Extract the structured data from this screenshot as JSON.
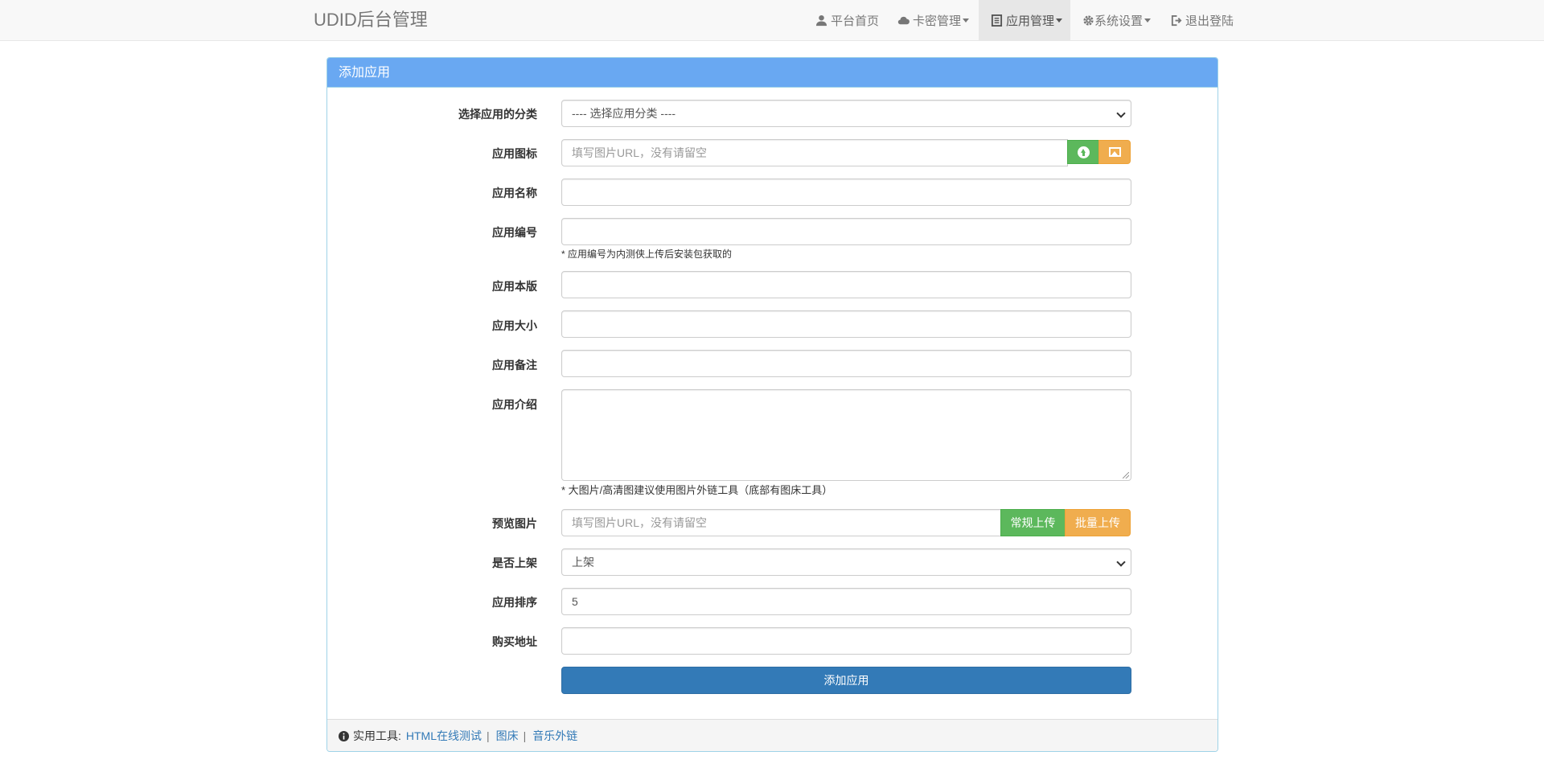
{
  "navbar": {
    "brand": "UDID后台管理",
    "items": [
      {
        "label": "平台首页",
        "icon": "user-icon",
        "dropdown": false,
        "active": false
      },
      {
        "label": "卡密管理",
        "icon": "cloud-icon",
        "dropdown": true,
        "active": false
      },
      {
        "label": "应用管理",
        "icon": "book-icon",
        "dropdown": true,
        "active": true
      },
      {
        "label": "系统设置",
        "icon": "gear-icon",
        "dropdown": true,
        "active": false
      },
      {
        "label": "退出登陆",
        "icon": "logout-icon",
        "dropdown": false,
        "active": false
      }
    ]
  },
  "panel": {
    "title": "添加应用"
  },
  "form": {
    "category": {
      "label": "选择应用的分类",
      "value": "---- 选择应用分类 ----"
    },
    "icon": {
      "label": "应用图标",
      "placeholder": "填写图片URL，没有请留空",
      "upload_icon": "upload-icon",
      "image_icon": "image-icon"
    },
    "name": {
      "label": "应用名称",
      "value": ""
    },
    "code": {
      "label": "应用编号",
      "value": "",
      "help": "* 应用编号为内测侠上传后安装包获取的"
    },
    "version": {
      "label": "应用本版",
      "value": ""
    },
    "size": {
      "label": "应用大小",
      "value": ""
    },
    "remark": {
      "label": "应用备注",
      "value": ""
    },
    "intro": {
      "label": "应用介绍",
      "value": "",
      "help": "* 大图片/高清图建议使用图片外链工具（底部有图床工具）"
    },
    "preview": {
      "label": "预览图片",
      "placeholder": "填写图片URL，没有请留空",
      "upload_label": "常规上传",
      "batch_label": "批量上传"
    },
    "listed": {
      "label": "是否上架",
      "value": "上架"
    },
    "order": {
      "label": "应用排序",
      "value": "5"
    },
    "buy_url": {
      "label": "购买地址",
      "value": ""
    },
    "submit_label": "添加应用"
  },
  "footer": {
    "prefix": "实用工具:",
    "links": [
      "HTML在线测试",
      "图床",
      "音乐外链"
    ],
    "separator": "|"
  },
  "colors": {
    "panel_heading": "#69a8f2",
    "primary": "#337ab7",
    "success": "#5cb85c",
    "warning": "#f0ad4e"
  }
}
